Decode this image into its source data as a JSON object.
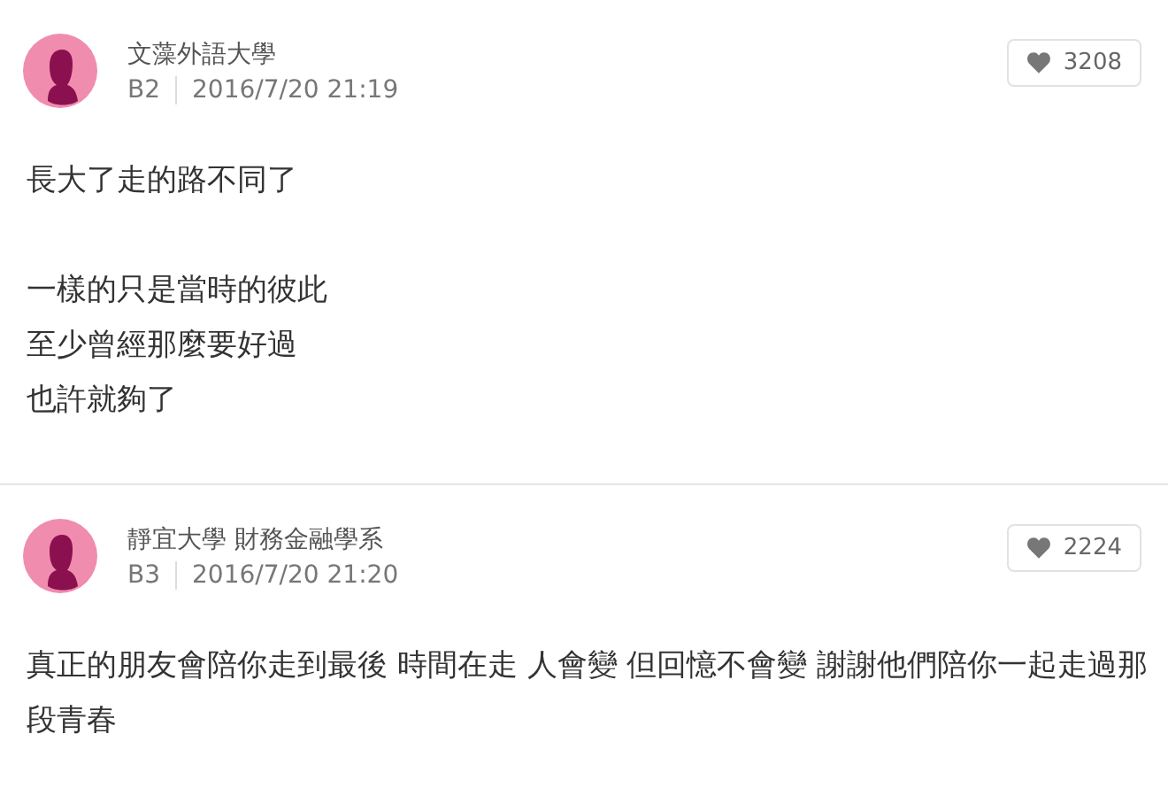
{
  "posts": [
    {
      "school": "文藻外語大學",
      "floor": "B2",
      "time": "2016/7/20 21:19",
      "likes": "3208",
      "paragraphs": [
        [
          "長大了走的路不同了"
        ],
        [
          "一樣的只是當時的彼此",
          "至少曾經那麼要好過",
          "也許就夠了"
        ]
      ]
    },
    {
      "school": "靜宜大學 財務金融學系",
      "floor": "B3",
      "time": "2016/7/20 21:20",
      "likes": "2224",
      "paragraphs": [
        [
          "真正的朋友會陪你走到最後 時間在走 人會變 但回憶不會變 謝謝他們陪你一起走過那段青春"
        ]
      ]
    }
  ]
}
